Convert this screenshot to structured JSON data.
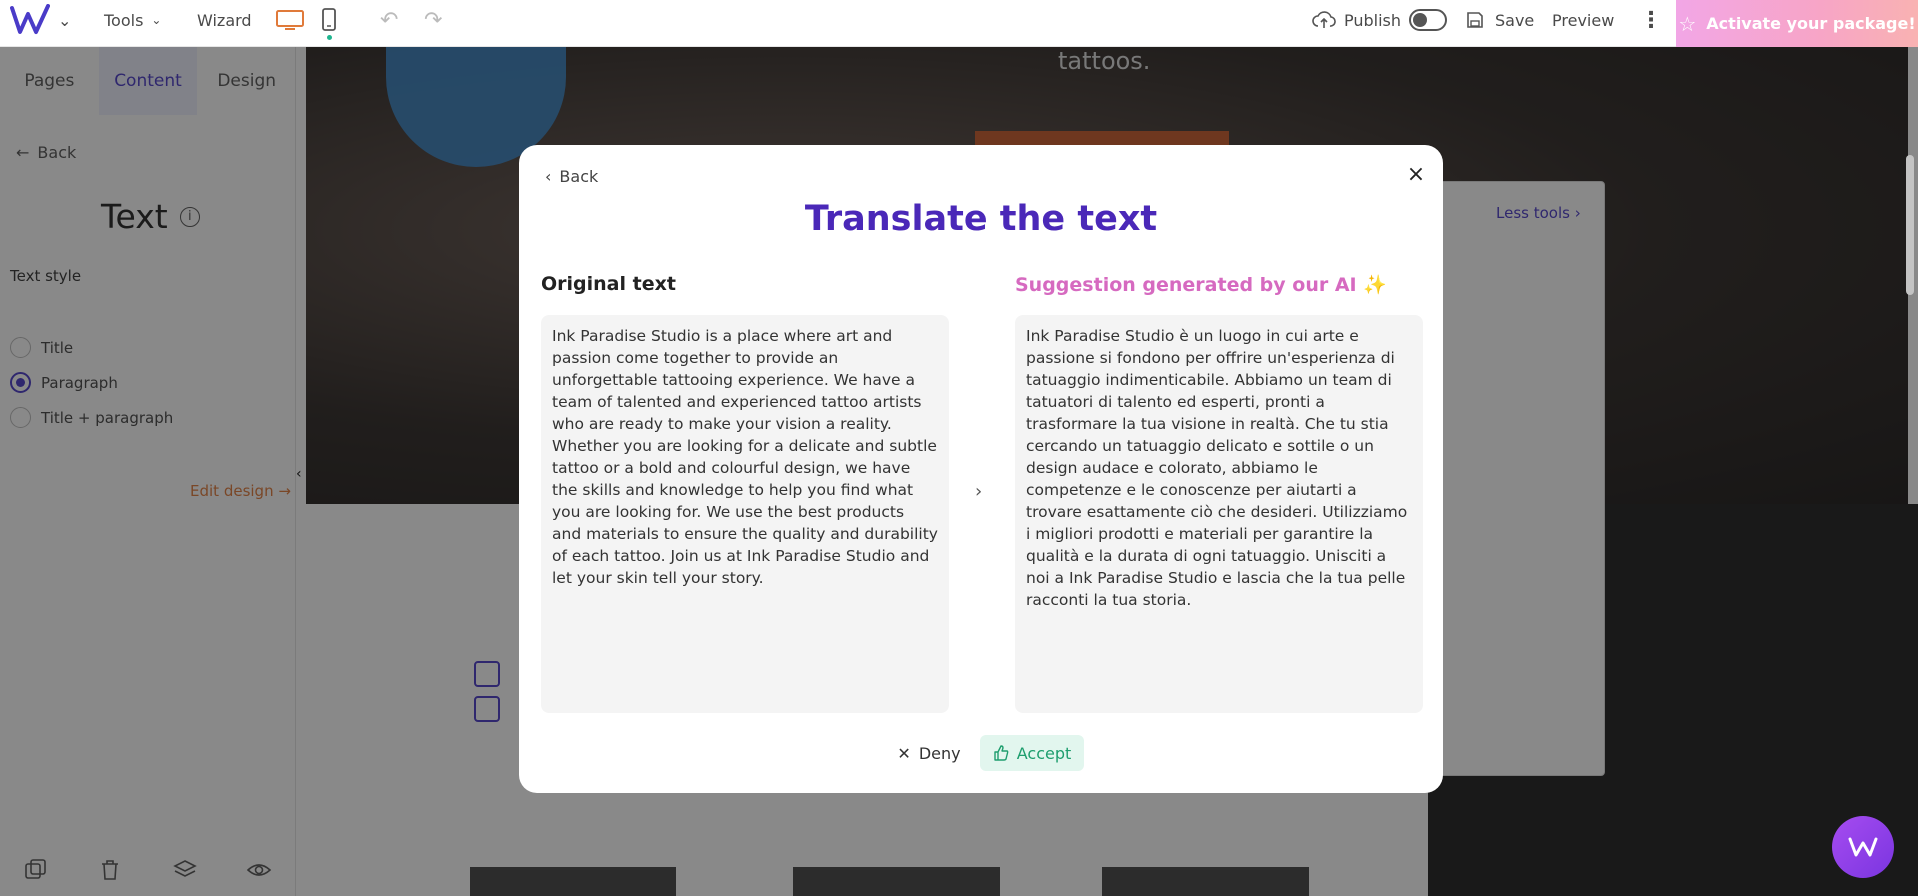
{
  "topbar": {
    "tools": "Tools",
    "wizard": "Wizard",
    "publish": "Publish",
    "save": "Save",
    "preview": "Preview",
    "activate": "Activate your package!"
  },
  "sidebar": {
    "tabs": [
      "Pages",
      "Content",
      "Design"
    ],
    "active_tab": "Content",
    "back": "Back",
    "title": "Text",
    "text_style_label": "Text style",
    "options": [
      "Title",
      "Paragraph",
      "Title + paragraph"
    ],
    "selected_option": "Paragraph",
    "edit_design": "Edit design →"
  },
  "canvas": {
    "hero_text": "tattoos.",
    "less_tools": "Less tools ›"
  },
  "modal": {
    "back": "Back",
    "title": "Translate the text",
    "original_title": "Original text",
    "ai_title": "Suggestion generated by our AI ✨",
    "original_text": "Ink Paradise Studio is a place where art and passion come together to provide an unforgettable tattooing experience. We have a team of talented and experienced tattoo artists who are ready to make your vision a reality. Whether you are looking for a delicate and subtle tattoo or a bold and colourful design, we have the skills and knowledge to help you find what you are looking for. We use the best products and materials to ensure the quality and durability of each tattoo. Join us at Ink Paradise Studio and let your skin tell your story.",
    "ai_text": "Ink Paradise Studio è un luogo in cui arte e passione si fondono per offrire un'esperienza di tatuaggio indimenticabile. Abbiamo un team di tatuatori di talento ed esperti, pronti a trasformare la tua visione in realtà. Che tu stia cercando un tatuaggio delicato e sottile o un design audace e colorato, abbiamo le competenze e le conoscenze per aiutarti a trovare esattamente ciò che desideri. Utilizziamo i migliori prodotti e materiali per garantire la qualità e la durata di ogni tatuaggio. Unisciti a noi a Ink Paradise Studio e lascia che la tua pelle racconti la tua storia.",
    "deny": "Deny",
    "accept": "Accept"
  },
  "colors": {
    "accent": "#4a28b8",
    "ai_title": "#d66ac0",
    "accept": "#1e9e6e"
  }
}
